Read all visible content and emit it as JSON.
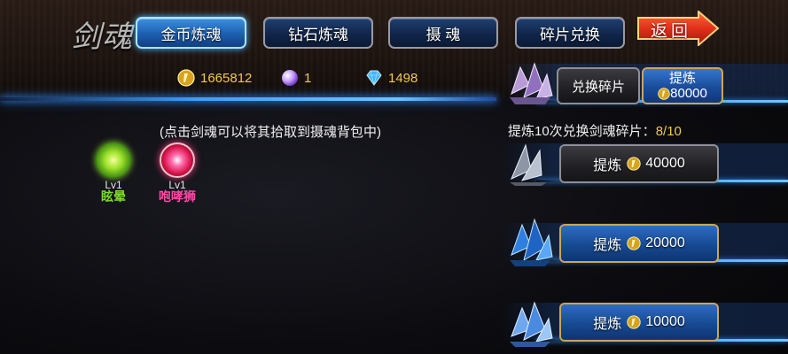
{
  "header": {
    "title": "剑魂",
    "tabs": [
      {
        "label": "金币炼魂",
        "active": true
      },
      {
        "label": "钻石炼魂",
        "active": false
      },
      {
        "label": "摄 魂",
        "active": false
      },
      {
        "label": "碎片兑换",
        "active": false
      }
    ],
    "back_label": "返回"
  },
  "currencies": {
    "gold": {
      "icon": "gold-coin-icon",
      "value": "1665812"
    },
    "orb": {
      "icon": "soul-orb-icon",
      "value": "1"
    },
    "diamond": {
      "icon": "diamond-icon",
      "value": "1498"
    }
  },
  "hint": "(点击剑魂可以将其拾取到摄魂背包中)",
  "souls": [
    {
      "level": "Lv1",
      "name": "眩晕",
      "color": "#7ddc2b"
    },
    {
      "level": "Lv1",
      "name": "咆哮狮",
      "color": "#ff4aa8"
    }
  ],
  "exchange": {
    "exchange_label": "兑换碎片",
    "refine_label": "提炼",
    "refine_cost": "80000",
    "progress_label": "提炼10次兑换剑魂碎片：",
    "progress_value": "8/10"
  },
  "refine_options": [
    {
      "label": "提炼",
      "cost": "40000",
      "style": "dark"
    },
    {
      "label": "提炼",
      "cost": "20000",
      "style": "blue"
    },
    {
      "label": "提炼",
      "cost": "10000",
      "style": "blue"
    }
  ],
  "colors": {
    "accent_blue": "#3aa0ff",
    "gold_text": "#f2c94c",
    "back_red": "#e83a1c"
  }
}
